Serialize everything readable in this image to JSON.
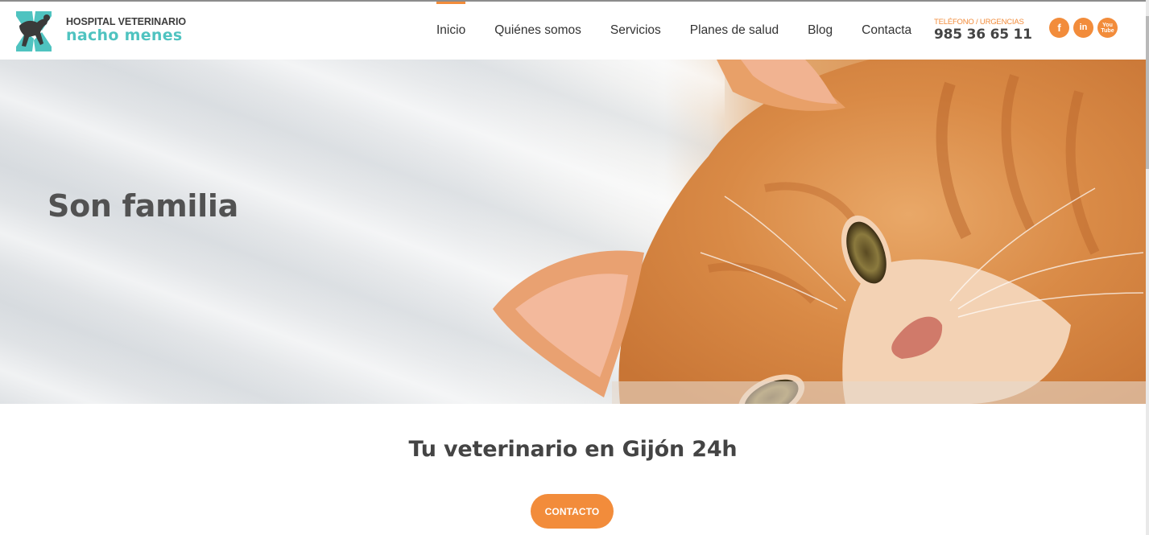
{
  "brand": {
    "line1": "HOSPITAL VETERINARIO",
    "line2": "nacho menes",
    "logo_icon": "vet-logo-icon",
    "accent_color": "#4fc3c0"
  },
  "nav": {
    "items": [
      {
        "label": "Inicio",
        "active": true
      },
      {
        "label": "Quiénes somos",
        "active": false
      },
      {
        "label": "Servicios",
        "active": false
      },
      {
        "label": "Planes de salud",
        "active": false
      },
      {
        "label": "Blog",
        "active": false
      },
      {
        "label": "Contacta",
        "active": false
      }
    ],
    "active_color": "#f28c3b"
  },
  "contact": {
    "label": "TELÉFONO / URGENCIAS",
    "phone": "985 36 65 11"
  },
  "socials": [
    {
      "icon": "facebook-icon",
      "glyph": "f"
    },
    {
      "icon": "linkedin-icon",
      "glyph": "in"
    },
    {
      "icon": "youtube-icon",
      "glyph": "You Tube"
    }
  ],
  "hero": {
    "title": "Son familia",
    "image": "orange-cat-photo"
  },
  "section": {
    "title": "Tu veterinario en Gijón 24h",
    "cta_label": "CONTACTO",
    "cta_color": "#f28c3b"
  }
}
